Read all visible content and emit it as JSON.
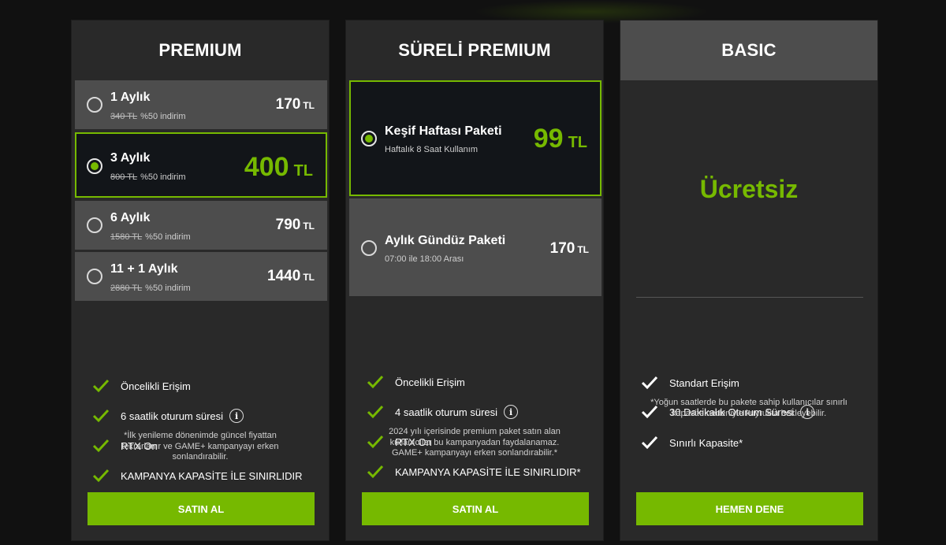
{
  "colors": {
    "accent": "#76b900",
    "card_bg": "#292929",
    "option_bg": "#4d4d4d",
    "selected_bg": "#121519"
  },
  "premium": {
    "title": "PREMIUM",
    "options": [
      {
        "name": "1 Aylık",
        "old_price": "340 TL",
        "discount": "%50 indirim",
        "price": "170",
        "currency": "TL",
        "selected": false
      },
      {
        "name": "3 Aylık",
        "old_price": "800 TL",
        "discount": "%50 indirim",
        "price": "400",
        "currency": "TL",
        "selected": true
      },
      {
        "name": "6 Aylık",
        "old_price": "1580 TL",
        "discount": "%50 indirim",
        "price": "790",
        "currency": "TL",
        "selected": false
      },
      {
        "name": "11 + 1 Aylık",
        "old_price": "2880 TL",
        "discount": "%50 indirim",
        "price": "1440",
        "currency": "TL",
        "selected": false
      }
    ],
    "features": [
      "Öncelikli Erişim",
      "6 saatlik oturum süresi",
      "RTX On",
      "KAMPANYA KAPASİTE İLE SINIRLIDIR"
    ],
    "note": [
      "*İlk yenileme dönenimde güncel fiyattan",
      "tekrarlanır ve GAME+ kampanyayı erken",
      "sonlandırabilir."
    ],
    "button": "SATIN AL"
  },
  "sureli": {
    "title": "SÜRELİ PREMIUM",
    "options": [
      {
        "name": "Keşif Haftası Paketi",
        "sub": "Haftalık 8 Saat Kullanım",
        "price": "99",
        "currency": "TL",
        "selected": true
      },
      {
        "name": "Aylık Gündüz Paketi",
        "sub": "07:00 ile 18:00 Arası",
        "price": "170",
        "currency": "TL",
        "selected": false
      }
    ],
    "features": [
      "Öncelikli Erişim",
      "4 saatlik oturum süresi",
      "RTX On",
      "KAMPANYA KAPASİTE İLE SINIRLIDIR*"
    ],
    "note": [
      "2024 yılı içerisinde premium paket satın alan",
      "kullanıcılar bu kampanyadan faydalanamaz.",
      "GAME+ kampanyayı erken sonlandırabilir.*"
    ],
    "button": "SATIN AL"
  },
  "basic": {
    "title": "BASIC",
    "price_label": "Ücretsiz",
    "features": [
      "Standart Erişim",
      "30 Dakikalık Oturum Süresi",
      "Sınırlı Kapasite*"
    ],
    "note": [
      "*Yoğun saatlerde bu pakete sahip kullanıcılar sınırlı",
      "kapasite nedeniyle kuyrukta bekleyebilir."
    ],
    "button": "HEMEN DENE"
  }
}
